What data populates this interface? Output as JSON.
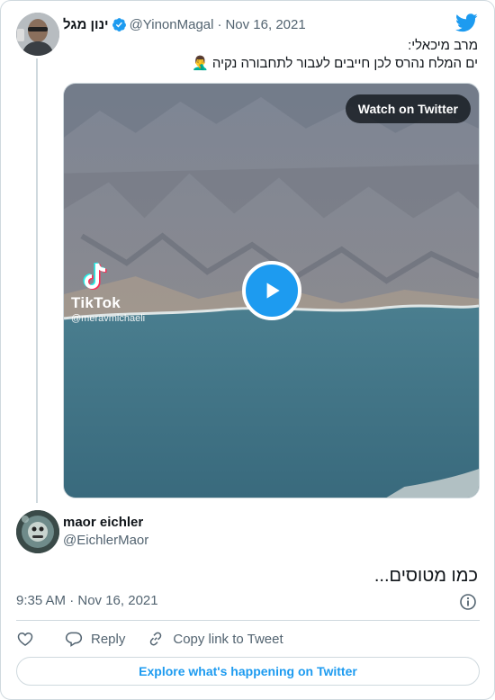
{
  "tweet": {
    "author_name": "ינון מגל",
    "author_handle": "@YinonMagal",
    "separator": "·",
    "date": "Nov 16, 2021",
    "text_line1": "מרב מיכאלי:",
    "text_line2": "ים המלח נהרס לכן חייבים לעבור לתחבורה נקיה 🤦‍♂️"
  },
  "media": {
    "watch_label": "Watch on Twitter",
    "watermark_brand": "TikTok",
    "watermark_handle": "@meravmichaeli"
  },
  "reply": {
    "author_name": "maor eichler",
    "author_handle": "@EichlerMaor",
    "text": "כמו מטוסים..."
  },
  "footer": {
    "timestamp": "9:35 AM · Nov 16, 2021",
    "reply_label": "Reply",
    "copy_label": "Copy link to Tweet",
    "explore_label": "Explore what's happening on Twitter"
  },
  "colors": {
    "accent": "#1d9bf0",
    "text_primary": "#0f1419",
    "text_secondary": "#536471",
    "border": "#cfd9de"
  },
  "icons": [
    "twitter-bird-icon",
    "verified-badge-icon",
    "play-icon",
    "tiktok-logo-icon",
    "info-icon",
    "heart-icon",
    "reply-bubble-icon",
    "link-icon"
  ]
}
